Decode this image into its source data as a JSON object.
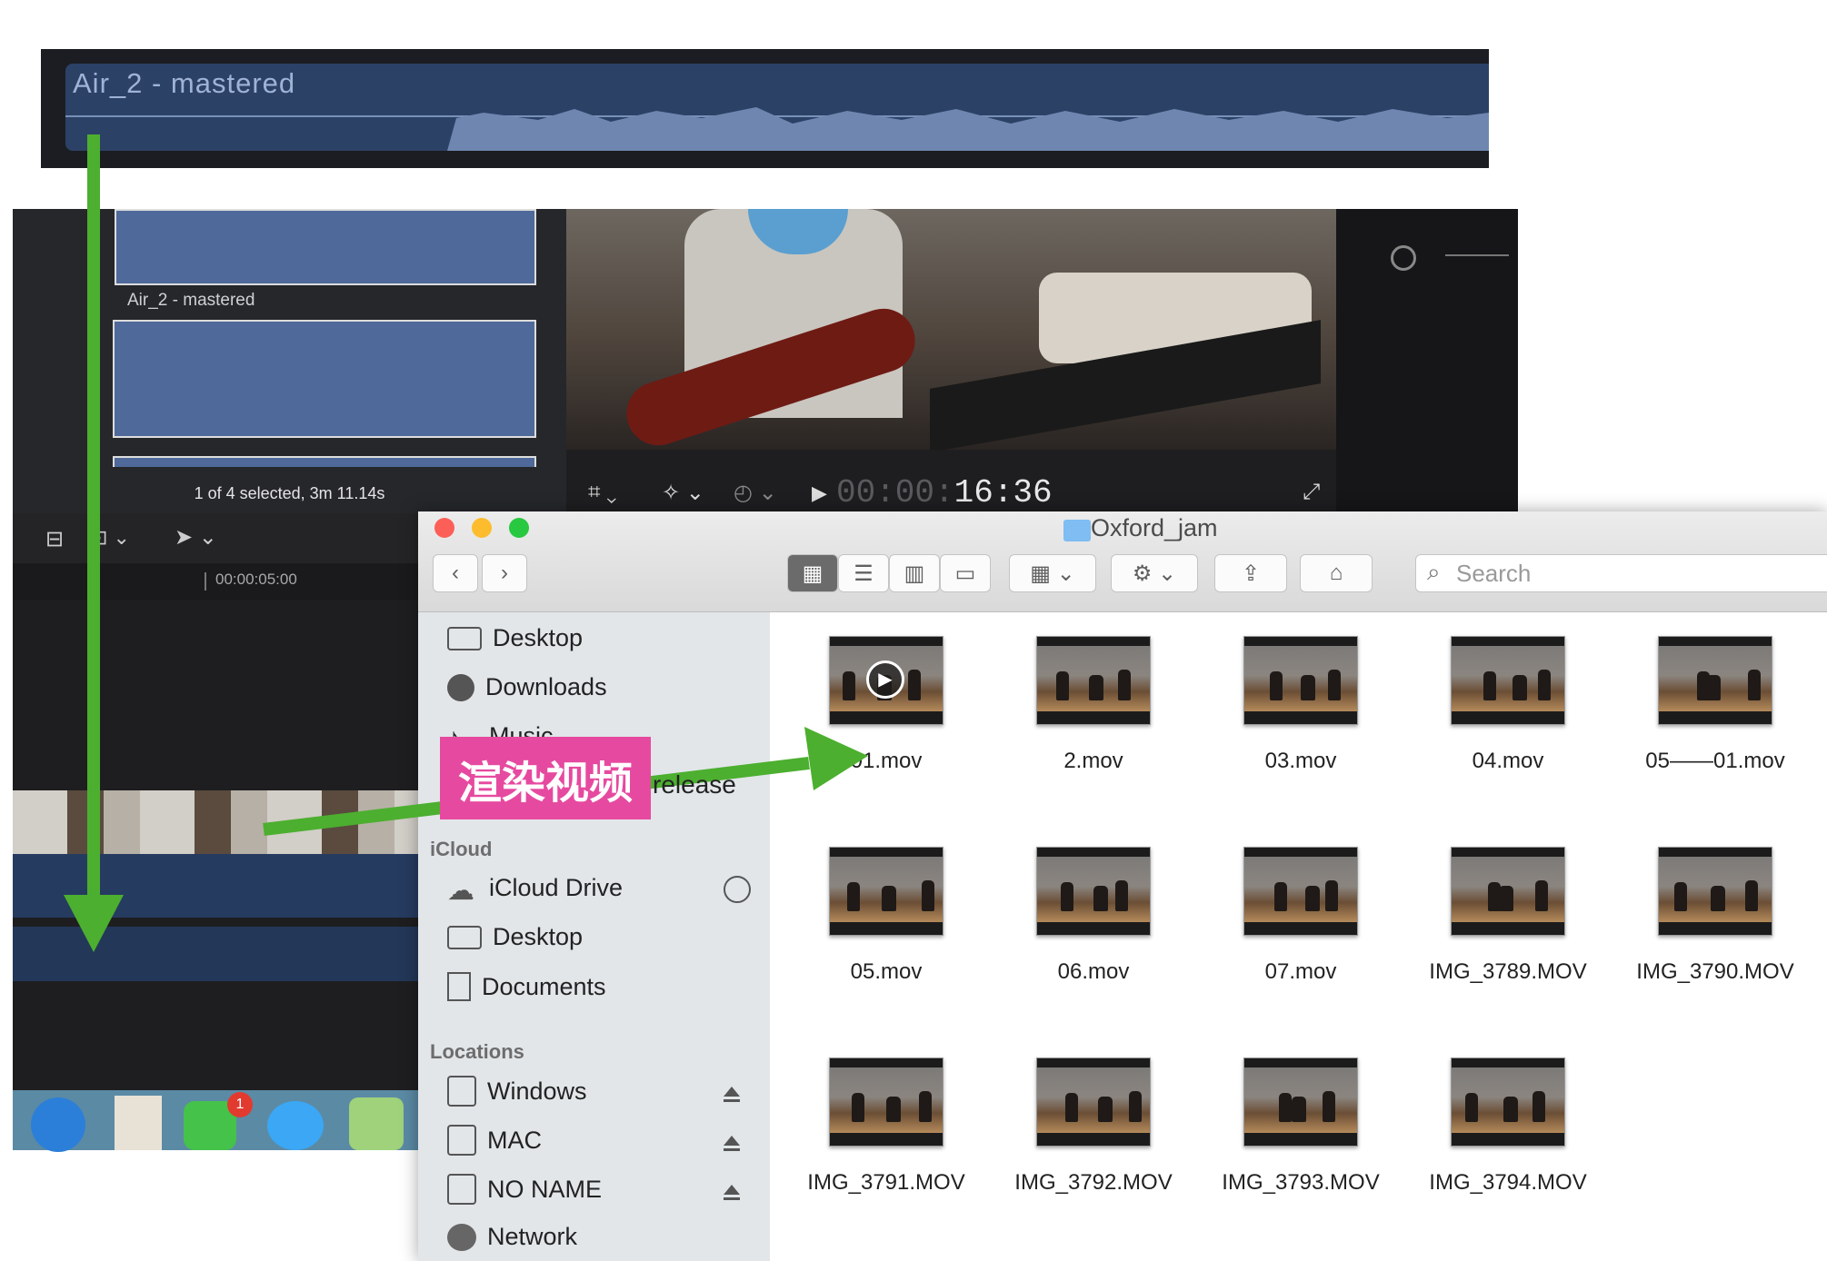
{
  "top_clip": {
    "title": "Air_2 - mastered"
  },
  "fcp": {
    "browser_caption": "Air_2 - mastered",
    "browser_status": "1 of 4 selected, 3m 11.14s",
    "timecode_dim": "00:00:",
    "timecode_lit": "16:36",
    "ruler_time": "00:00:05:00"
  },
  "annotation": {
    "label": "渲染视频",
    "ribbon_text": "release"
  },
  "dock": {
    "badge": "1"
  },
  "finder": {
    "title": "Oxford_jam",
    "search_placeholder": "Search",
    "toolbar": {
      "back": "‹",
      "forward": "›",
      "view_icon": "▦",
      "view_list": "☰",
      "view_columns": "▥",
      "view_gallery": "▭",
      "group": "▦ ⌄",
      "action": "⚙ ⌄",
      "share": "⇪",
      "tag": "⌂"
    },
    "sidebar": {
      "favorites": [
        {
          "label": "Desktop",
          "icon": "desktop-icon"
        },
        {
          "label": "Downloads",
          "icon": "downloads-icon"
        },
        {
          "label": "Music",
          "icon": "music-icon"
        }
      ],
      "icloud_header": "iCloud",
      "icloud": [
        {
          "label": "iCloud Drive",
          "icon": "cloud-icon"
        },
        {
          "label": "Desktop",
          "icon": "desktop-icon"
        },
        {
          "label": "Documents",
          "icon": "document-icon"
        }
      ],
      "locations_header": "Locations",
      "locations": [
        {
          "label": "Windows",
          "icon": "drive-icon"
        },
        {
          "label": "MAC",
          "icon": "drive-icon"
        },
        {
          "label": "NO NAME",
          "icon": "drive-icon"
        },
        {
          "label": "Network",
          "icon": "network-icon"
        }
      ]
    },
    "files": [
      {
        "name": "01.mov"
      },
      {
        "name": "2.mov"
      },
      {
        "name": "03.mov"
      },
      {
        "name": "04.mov"
      },
      {
        "name": "05——01.mov"
      },
      {
        "name": "05.mov"
      },
      {
        "name": "06.mov"
      },
      {
        "name": "07.mov"
      },
      {
        "name": "IMG_3789.MOV"
      },
      {
        "name": "IMG_3790.MOV"
      },
      {
        "name": "IMG_3791.MOV"
      },
      {
        "name": "IMG_3792.MOV"
      },
      {
        "name": "IMG_3793.MOV"
      },
      {
        "name": "IMG_3794.MOV"
      }
    ]
  },
  "colors": {
    "arrow": "#4caf2f",
    "label_bg": "#e64aa0",
    "clip_blue": "#2c4166"
  }
}
